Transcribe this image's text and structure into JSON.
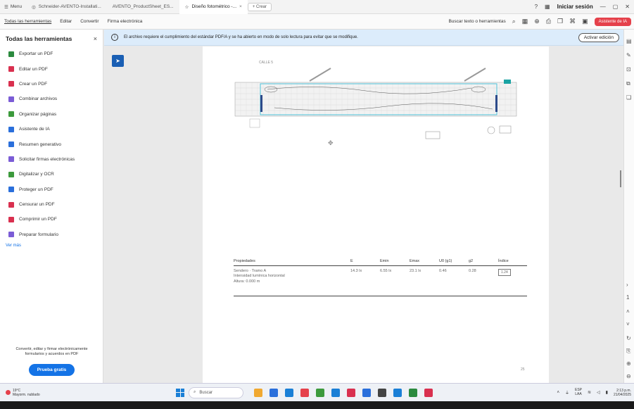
{
  "tabbar": {
    "menu_label": "Menu",
    "tabs": [
      {
        "label": "Schneider-AVENTO-Installati..."
      },
      {
        "label": "AVENTO_ProductSheet_ES..."
      },
      {
        "label": "Diseño fotométrico -...",
        "close": "×"
      }
    ],
    "new_tab_label": "+ Crear",
    "sign_in": "Iniciar sesión"
  },
  "toolbar": {
    "menu": [
      "Todas las herramientas",
      "Editar",
      "Convertir",
      "Firma electrónica"
    ],
    "search_label": "Buscar texto o herramientas",
    "ai_button": "Asistente de IA"
  },
  "left_panel": {
    "title": "Todas las herramientas",
    "close": "×",
    "tools": [
      {
        "label": "Exportar un PDF",
        "color": "#2b8a3e"
      },
      {
        "label": "Editar un PDF",
        "color": "#d9304f"
      },
      {
        "label": "Crear un PDF",
        "color": "#d9304f"
      },
      {
        "label": "Combinar archivos",
        "color": "#7b5cd6"
      },
      {
        "label": "Organizar páginas",
        "color": "#3c9a3c"
      },
      {
        "label": "Asistente de IA",
        "color": "#2a6fdb"
      },
      {
        "label": "Resumen generativo",
        "color": "#2a6fdb"
      },
      {
        "label": "Solicitar firmas electrónicas",
        "color": "#7b5cd6"
      },
      {
        "label": "Digitalizar y OCR",
        "color": "#3c9a3c"
      },
      {
        "label": "Proteger un PDF",
        "color": "#2a6fdb"
      },
      {
        "label": "Censurar un PDF",
        "color": "#d9304f"
      },
      {
        "label": "Comprimir un PDF",
        "color": "#d9304f"
      },
      {
        "label": "Preparar formulario",
        "color": "#7b5cd6"
      }
    ],
    "see_more": "Ver más",
    "promo_text": "Convertir, editar y firmar electrónicamente formularios y acuerdos en PDF",
    "promo_button": "Prueba gratis"
  },
  "banner": {
    "icon": "info-icon",
    "text": "El archivo requiere el cumplimiento del estándar PDF/A y se ha abierto en modo de solo lectura para evitar que se modifique.",
    "button": "Activar edición"
  },
  "document": {
    "drawing_label": "CALLE 5",
    "table": {
      "headers": [
        "Propiedades",
        "E",
        "Emin",
        "Emax",
        "U0 (g1)",
        "g2",
        "Índice"
      ],
      "row": {
        "name_lines": [
          "Sendero · Tramo A",
          "Intensidad lumínica horizontal",
          "Altura: 0.000 m"
        ],
        "values": [
          "14.3 lx",
          "6.55 lx",
          "23.1 lx",
          "0.46",
          "0.28"
        ],
        "index": "1.24"
      }
    },
    "page_number": "25"
  },
  "taskbar": {
    "weather_temp": "19°C",
    "weather_desc": "Mayorm. nublado",
    "search_placeholder": "Buscar",
    "apps": [
      "#f0a830",
      "#2a6fdb",
      "#1a7fd6",
      "#e5414b",
      "#3c9a3c",
      "#1a7fd6",
      "#d9304f",
      "#2a6fdb",
      "#444444",
      "#1a7fd6",
      "#2b8a3e",
      "#d9304f"
    ],
    "lang": "ESP",
    "lang_sub": "LAA",
    "time": "2:13 p.m.",
    "date": "21/04/2025"
  }
}
